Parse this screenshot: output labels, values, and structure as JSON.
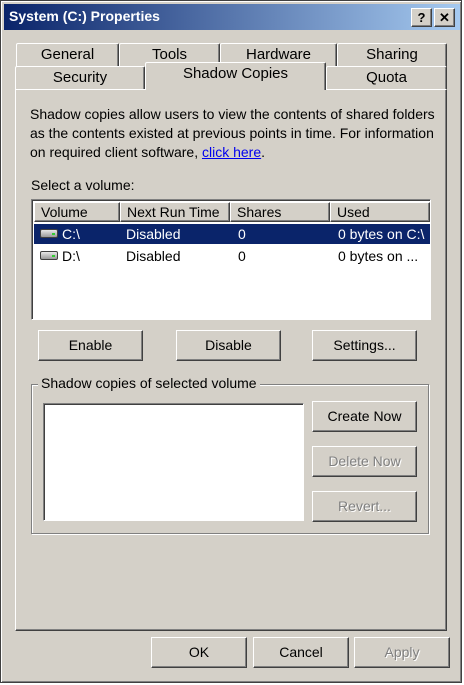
{
  "window": {
    "title": "System (C:) Properties",
    "help_button": "?",
    "close_button": "✕"
  },
  "tabs": {
    "row1": [
      "General",
      "Tools",
      "Hardware",
      "Sharing"
    ],
    "row2": [
      "Security",
      "Shadow Copies",
      "Quota"
    ],
    "active": "Shadow Copies"
  },
  "description": {
    "text": "Shadow copies allow users to view the contents of shared folders as the contents existed at previous points in time. For information on required client software, ",
    "link": "click here",
    "after_link": "."
  },
  "volume_section": {
    "label": "Select a volume:",
    "columns": [
      "Volume",
      "Next Run Time",
      "Shares",
      "Used"
    ],
    "rows": [
      {
        "volume": "C:\\",
        "next_run": "Disabled",
        "shares": "0",
        "used": "0 bytes on C:\\",
        "selected": true,
        "icon": "drive-icon"
      },
      {
        "volume": "D:\\",
        "next_run": "Disabled",
        "shares": "0",
        "used": "0 bytes on ...",
        "selected": false,
        "icon": "drive-icon"
      }
    ]
  },
  "volume_buttons": {
    "enable": "Enable",
    "disable": "Disable",
    "settings": "Settings..."
  },
  "shadow_copies": {
    "group_label": "Shadow copies of selected volume",
    "create_now": "Create Now",
    "delete_now": "Delete Now",
    "revert": "Revert..."
  },
  "footer": {
    "ok": "OK",
    "cancel": "Cancel",
    "apply": "Apply"
  },
  "colors": {
    "face": "#d4d0c8",
    "selection": "#0a246a",
    "title_gradient_start": "#0a246a",
    "title_gradient_end": "#a6caf0",
    "link": "#0000ee"
  }
}
